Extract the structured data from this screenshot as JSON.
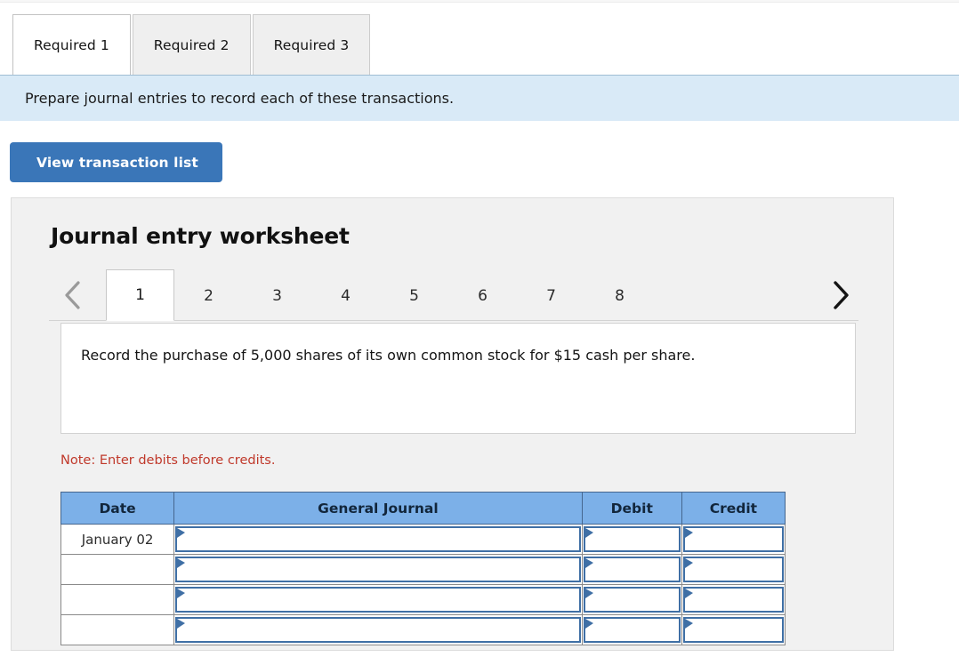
{
  "required_tabs": [
    {
      "label": "Required 1",
      "active": true
    },
    {
      "label": "Required 2",
      "active": false
    },
    {
      "label": "Required 3",
      "active": false
    }
  ],
  "instruction": {
    "text": "Prepare journal entries to record each of these transactions."
  },
  "toolbar": {
    "view_transaction_list_label": "View transaction list"
  },
  "worksheet": {
    "title": "Journal entry worksheet",
    "pager": {
      "prev_icon": "chevron-left-icon",
      "next_icon": "chevron-right-icon",
      "prev_enabled": false,
      "next_enabled": true,
      "pages": [
        "1",
        "2",
        "3",
        "4",
        "5",
        "6",
        "7",
        "8"
      ],
      "active_page": "1"
    },
    "transaction_description": "Record the purchase of 5,000 shares of its own common stock for $15 cash per share.",
    "note": "Note: Enter debits before credits.",
    "table": {
      "headers": [
        "Date",
        "General Journal",
        "Debit",
        "Credit"
      ],
      "rows": [
        {
          "date": "January 02",
          "general_journal": "",
          "debit": "",
          "credit": ""
        },
        {
          "date": "",
          "general_journal": "",
          "debit": "",
          "credit": ""
        },
        {
          "date": "",
          "general_journal": "",
          "debit": "",
          "credit": ""
        },
        {
          "date": "",
          "general_journal": "",
          "debit": "",
          "credit": ""
        }
      ]
    }
  },
  "colors": {
    "banner_bg": "#d9eaf7",
    "button_blue": "#3a76b8",
    "table_header_blue": "#7cb0e8",
    "input_border_blue": "#3f6fa5",
    "note_red": "#c0392b",
    "panel_bg": "#f1f1f1"
  }
}
